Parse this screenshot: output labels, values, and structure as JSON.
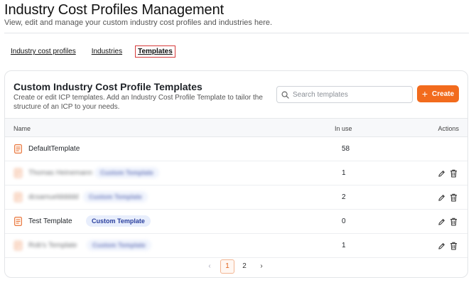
{
  "header": {
    "title": "Industry Cost Profiles Management",
    "subtitle": "View, edit and manage your custom industry cost profiles and industries here."
  },
  "tabs": [
    {
      "label": "Industry cost profiles",
      "active": false
    },
    {
      "label": "Industries",
      "active": false
    },
    {
      "label": "Templates",
      "active": true
    }
  ],
  "card": {
    "title": "Custom Industry Cost Profile Templates",
    "description": "Create or edit ICP templates. Add an Industry Cost Profile Template to tailor the structure of an ICP to your needs.",
    "search_placeholder": "Search templates",
    "create_label": "Create"
  },
  "table": {
    "columns": {
      "name": "Name",
      "in_use": "In use",
      "actions": "Actions"
    },
    "rows": [
      {
        "name": "DefaultTemplate",
        "badge": "",
        "in_use": "58",
        "actions": false,
        "redacted": false
      },
      {
        "name": "Thomas Heinemann",
        "badge": "Custom Template",
        "in_use": "1",
        "actions": true,
        "redacted": true
      },
      {
        "name": "dcsamuelddddd",
        "badge": "Custom Template",
        "in_use": "2",
        "actions": true,
        "redacted": true
      },
      {
        "name": "Test Template",
        "badge": "Custom Template",
        "in_use": "0",
        "actions": true,
        "redacted": false
      },
      {
        "name": "Rob's Template",
        "badge": "Custom Template",
        "in_use": "1",
        "actions": true,
        "redacted": true
      }
    ]
  },
  "pagination": {
    "prev": "‹",
    "pages": [
      "1",
      "2"
    ],
    "current": "1",
    "next": "›"
  },
  "colors": {
    "accent": "#f26b1d",
    "badge_bg": "#e8eefc",
    "badge_text": "#2a3f9e",
    "active_tab_outline": "#d63a3a"
  },
  "icons": {
    "template": "template-doc-icon",
    "search": "search-icon",
    "edit": "pencil-icon",
    "delete": "trash-icon"
  }
}
